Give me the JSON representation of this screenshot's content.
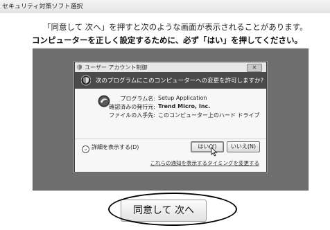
{
  "window": {
    "title": "セキュリティ対策ソフト選択"
  },
  "instructions": {
    "line1": "「同意して 次へ」を押すと次のような画面が表示されることがあります。",
    "line2": "コンピューターを正しく設定するために、必ず「はい」を押してください。"
  },
  "uac_dialog": {
    "title": "ユーザー アカウント制御",
    "close_label": "✕",
    "question": "次のプログラムにこのコンピューターへの変更を許可しますか?",
    "fields": [
      {
        "key": "プログラム名:",
        "value": "Setup Application"
      },
      {
        "key": "確認済みの発行元:",
        "value": "Trend Micro, Inc."
      },
      {
        "key": "ファイルの入手先:",
        "value": "このコンピューター上のハード ドライブ"
      }
    ],
    "details_label": "詳細を表示する(D)",
    "yes_label": "はい(Y)",
    "no_label": "いいえ(N)",
    "notify_link": "これらの通知を表示するタイミングを変更する"
  },
  "agree_button": {
    "label": "同意して 次へ"
  },
  "icons": {
    "shield": "uac-shield-icon",
    "program": "program-icon",
    "cursor": "mouse-cursor-icon",
    "details": "chevron-down-icon"
  }
}
